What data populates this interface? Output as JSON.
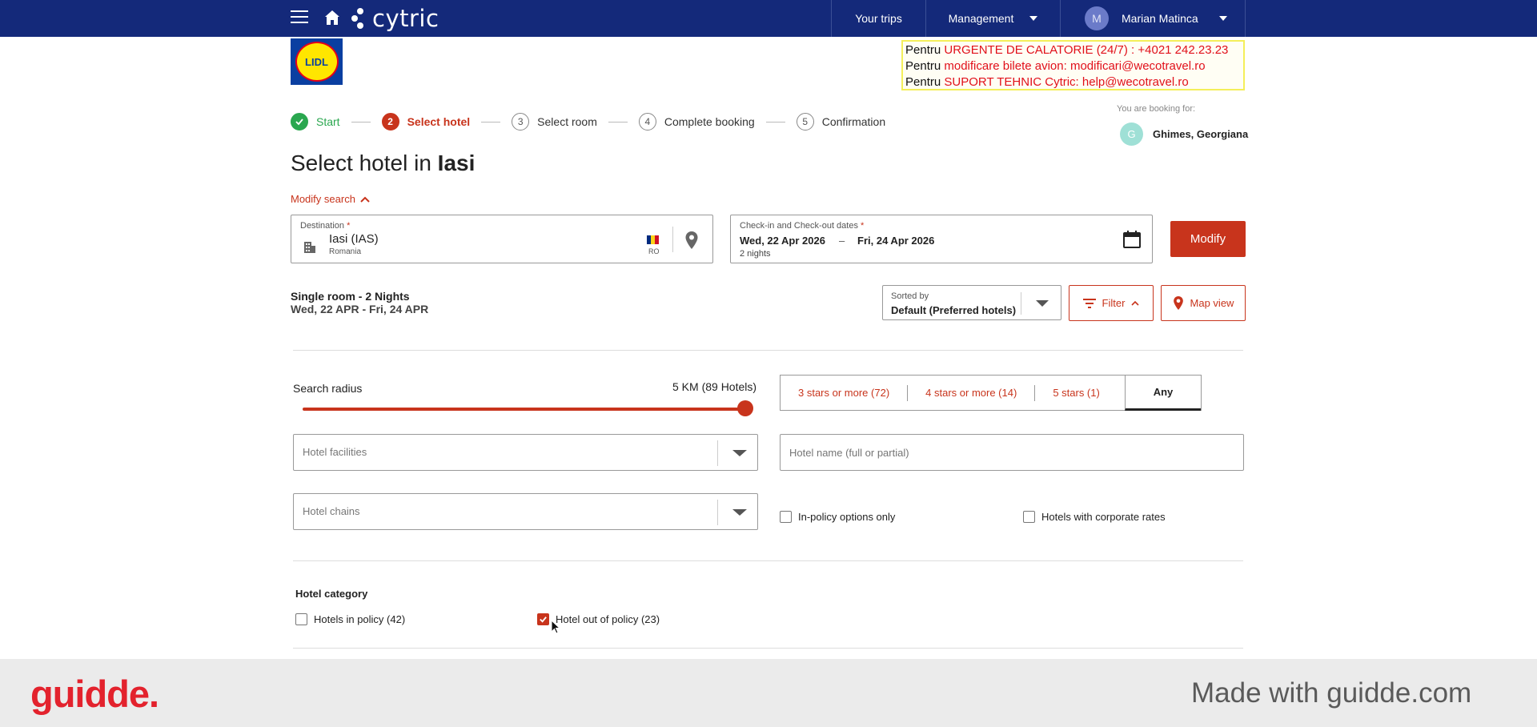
{
  "nav": {
    "logo": "cytric",
    "your_trips": "Your trips",
    "management": "Management",
    "user_initial": "M",
    "user_name": "Marian Matinca"
  },
  "company_logo_text": "LIDL",
  "infobox": {
    "line1_prefix": "Pentru ",
    "line1_red": "URGENTE DE CALATORIE (24/7) : +4021 242.23.23",
    "line2_prefix": "Pentru ",
    "line2_red": "modificare bilete avion:  modificari@wecotravel.ro",
    "line3_prefix": "Pentru ",
    "line3_red": "SUPORT TEHNIC Cytric:  help@wecotravel.ro"
  },
  "steps": [
    {
      "num": "",
      "label": "Start"
    },
    {
      "num": "2",
      "label": "Select hotel"
    },
    {
      "num": "3",
      "label": "Select room"
    },
    {
      "num": "4",
      "label": "Complete booking"
    },
    {
      "num": "5",
      "label": "Confirmation"
    }
  ],
  "booking_for": {
    "label": "You are booking for:",
    "initial": "G",
    "name": "Ghimes, Georgiana"
  },
  "title": {
    "prefix": "Select hotel in ",
    "city": "Iasi"
  },
  "modify_search": "Modify search",
  "destination": {
    "label": "Destination",
    "required": "*",
    "value": "Iasi (IAS)",
    "country": "Romania",
    "country_code": "RO"
  },
  "dates": {
    "label": "Check-in and Check-out dates",
    "required": "*",
    "checkin": "Wed, 22 Apr 2026",
    "dash": "–",
    "checkout": "Fri, 24 Apr 2026",
    "nights": "2 nights"
  },
  "modify_button": "Modify",
  "summary": {
    "line1": "Single room - 2 Nights",
    "line2": "Wed, 22 APR - Fri, 24 APR"
  },
  "sort": {
    "label": "Sorted by",
    "value": "Default (Preferred hotels)"
  },
  "filter_button": "Filter",
  "map_button": "Map view",
  "search_radius": {
    "label": "Search radius",
    "value": "5 KM (89 Hotels)",
    "level": 1.0
  },
  "stars": {
    "options": [
      "3 stars or more (72)",
      "4 stars or more (14)",
      "5 stars (1)"
    ],
    "any": "Any"
  },
  "hotel_facilities_placeholder": "Hotel facilities",
  "hotel_chains_placeholder": "Hotel chains",
  "hotel_name_placeholder": "Hotel name (full or partial)",
  "in_policy_only": "In-policy options only",
  "corporate_rates": "Hotels with corporate rates",
  "hotel_category": {
    "title": "Hotel category",
    "in_policy": "Hotels in policy (42)",
    "out_of_policy": "Hotel out of policy (23)"
  },
  "footer": {
    "brand": "guidde.",
    "made_with": "Made with guidde.com"
  },
  "colors": {
    "nav": "#14297a",
    "accent": "#c8341c",
    "done": "#2aa74f"
  }
}
